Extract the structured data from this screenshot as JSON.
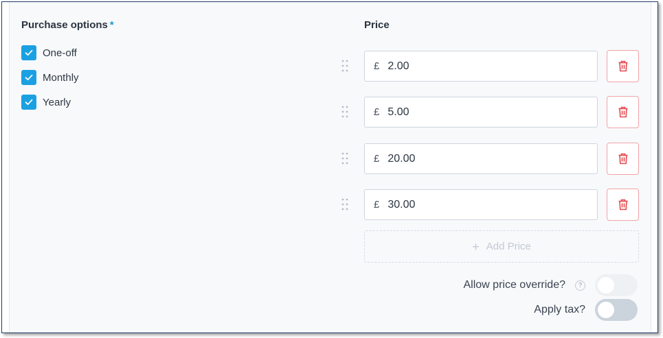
{
  "purchase_options": {
    "heading": "Purchase options",
    "required_mark": "*",
    "options": [
      {
        "label": "One-off",
        "checked": true
      },
      {
        "label": "Monthly",
        "checked": true
      },
      {
        "label": "Yearly",
        "checked": true
      }
    ]
  },
  "prices": {
    "heading": "Price",
    "currency_symbol": "£",
    "rows": [
      {
        "amount": "2.00"
      },
      {
        "amount": "5.00"
      },
      {
        "amount": "20.00"
      },
      {
        "amount": "30.00"
      }
    ],
    "add_label": "Add Price",
    "add_icon": "plus-icon",
    "delete_icon": "trash-icon",
    "drag_icon": "drag-handle-icon"
  },
  "settings": {
    "allow_override_label": "Allow price override?",
    "allow_override_help_icon": "question-icon",
    "allow_override_on": false,
    "apply_tax_label": "Apply tax?",
    "apply_tax_on": false
  },
  "colors": {
    "checkbox": "#1ba0e2",
    "required": "#1a9ad6",
    "delete": "#e5484d",
    "panel_bg": "#f7f9fb"
  }
}
